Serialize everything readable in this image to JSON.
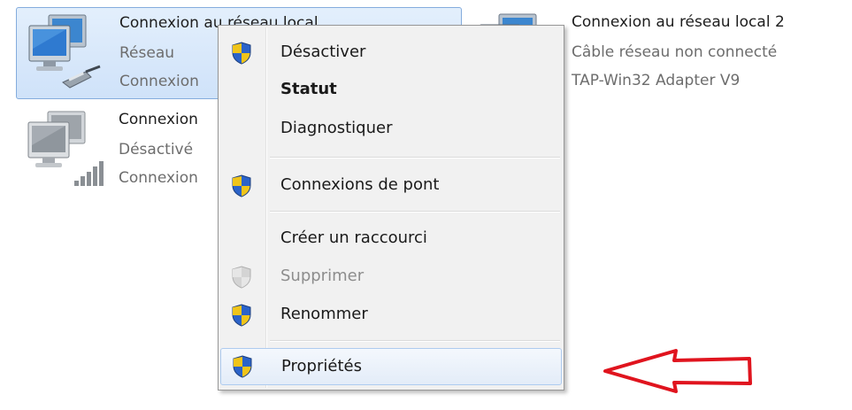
{
  "connections": [
    {
      "name": "Connexion au réseau local",
      "line2": "Réseau",
      "line3": "Connexion",
      "icon": "network-adapter-cable-icon",
      "selected": true
    },
    {
      "name": "Connexion",
      "line2": "Désactivé",
      "line3": "Connexion",
      "icon": "network-adapter-wireless-icon",
      "selected": false
    },
    {
      "name": "Connexion au réseau local 2",
      "line2": "Câble réseau non connecté",
      "line3": "TAP-Win32 Adapter V9",
      "icon": "network-adapter-icon",
      "selected": false
    }
  ],
  "context_menu": {
    "items": [
      {
        "label": "Désactiver",
        "icon": "uac-shield-icon"
      },
      {
        "label": "Statut",
        "bold": true
      },
      {
        "label": "Diagnostiquer"
      },
      {
        "label": "Connexions de pont",
        "icon": "uac-shield-icon"
      },
      {
        "label": "Créer un raccourci"
      },
      {
        "label": "Supprimer",
        "icon": "uac-shield-icon",
        "disabled": true
      },
      {
        "label": "Renommer",
        "icon": "uac-shield-icon"
      },
      {
        "label": "Propriétés",
        "icon": "uac-shield-icon",
        "highlighted": true
      }
    ]
  },
  "annotation": {
    "icon": "red-arrow-icon",
    "color": "#e0141e"
  },
  "colors": {
    "selection_bg": "#d5e6fa",
    "selection_border": "#84acdd",
    "menu_bg": "#f1f1f1",
    "subtext": "#6d6d6d"
  }
}
